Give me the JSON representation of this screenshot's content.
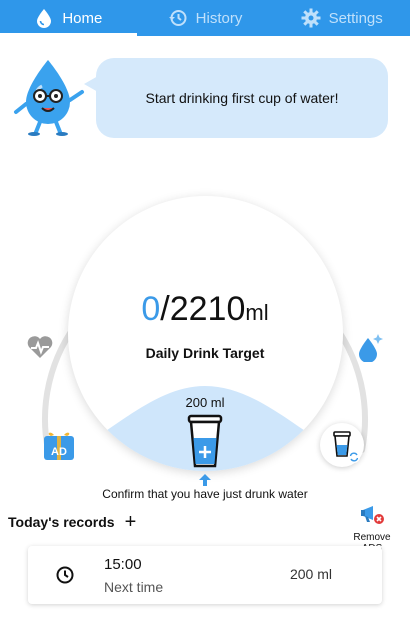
{
  "tabs": [
    {
      "label": "Home",
      "icon": "water-drop-icon",
      "active": true
    },
    {
      "label": "History",
      "icon": "history-icon",
      "active": false
    },
    {
      "label": "Settings",
      "icon": "gear-icon",
      "active": false
    }
  ],
  "bubble": {
    "text": "Start drinking first cup of water!"
  },
  "progress": {
    "current": "0",
    "slash_target": "/2210",
    "unit": "ml",
    "fraction": 0
  },
  "target_label": "Daily Drink Target",
  "cup": {
    "amount_label": "200 ml",
    "confirm_text": "Confirm that you have just drunk water"
  },
  "ad_badge": "AD",
  "records": {
    "title": "Today's records",
    "remove_ads": "Remove ADS",
    "items": [
      {
        "time": "15:00",
        "subtitle": "Next time",
        "amount": "200 ml"
      }
    ]
  },
  "colors": {
    "accent": "#2f97ea",
    "water": "#cfe6fb",
    "bubble": "#d5e9fb"
  }
}
